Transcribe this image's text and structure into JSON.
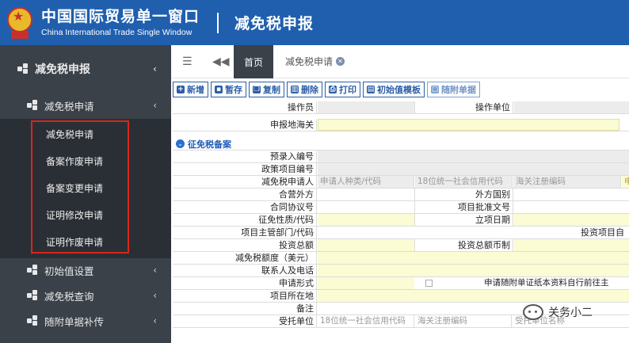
{
  "header": {
    "brand_cn": "中国国际贸易单一窗口",
    "brand_en": "China International Trade Single Window",
    "title": "减免税申报",
    "bg_color": "#1f5fae"
  },
  "sidebar": {
    "top_item": "减免税申报",
    "group": "减免税申请",
    "sub_items": [
      "减免税申请",
      "备案作废申请",
      "备案变更申请",
      "证明修改申请",
      "证明作废申请"
    ],
    "other_items": [
      "初始值设置",
      "减免税查询",
      "随附单据补传"
    ],
    "icons": [
      "cubes-icon",
      "chevron-left-icon"
    ]
  },
  "tabs": {
    "home": "首页",
    "active": "减免税申请"
  },
  "toolbar": {
    "add": "新增",
    "save": "暂存",
    "copy": "复制",
    "delete": "删除",
    "print": "打印",
    "init_template": "初始值模板",
    "attach": "随附单据"
  },
  "form": {
    "operator": "操作员",
    "operator_unit": "操作单位",
    "declare_customs": "申报地海关",
    "section_title": "征免税备案",
    "pre_entry_no": "预录入编号",
    "policy_item_no": "政策项目编号",
    "applicant": "减免税申请人",
    "applicant_ph1": "申请人种类/代码",
    "applicant_ph2": "18位统一社会信用代码",
    "applicant_ph3": "海关注册编码",
    "applicant_ph4": "申",
    "jv_party": "合营外方",
    "foreign_country": "外方国别",
    "contract_no": "合同协议号",
    "approval_no": "项目批准文号",
    "exemption_nature": "征免性质/代码",
    "setup_date": "立项日期",
    "dept_code": "项目主管部门/代码",
    "invest_item": "投资项目自",
    "total_invest": "投资总额",
    "invest_currency": "投资总额币制",
    "exempt_amount": "减免税额度（美元）",
    "contact": "联系人及电话",
    "apply_form": "申请形式",
    "attach_note": "申请随附单证纸本资料自行前往主",
    "location": "项目所在地",
    "remark": "备注",
    "agent": "受托单位",
    "agent_ph1": "18位统一社会信用代码",
    "agent_ph2": "海关注册编码",
    "agent_ph3": "受托单位名称"
  },
  "watermark": {
    "text": "关务小二"
  }
}
